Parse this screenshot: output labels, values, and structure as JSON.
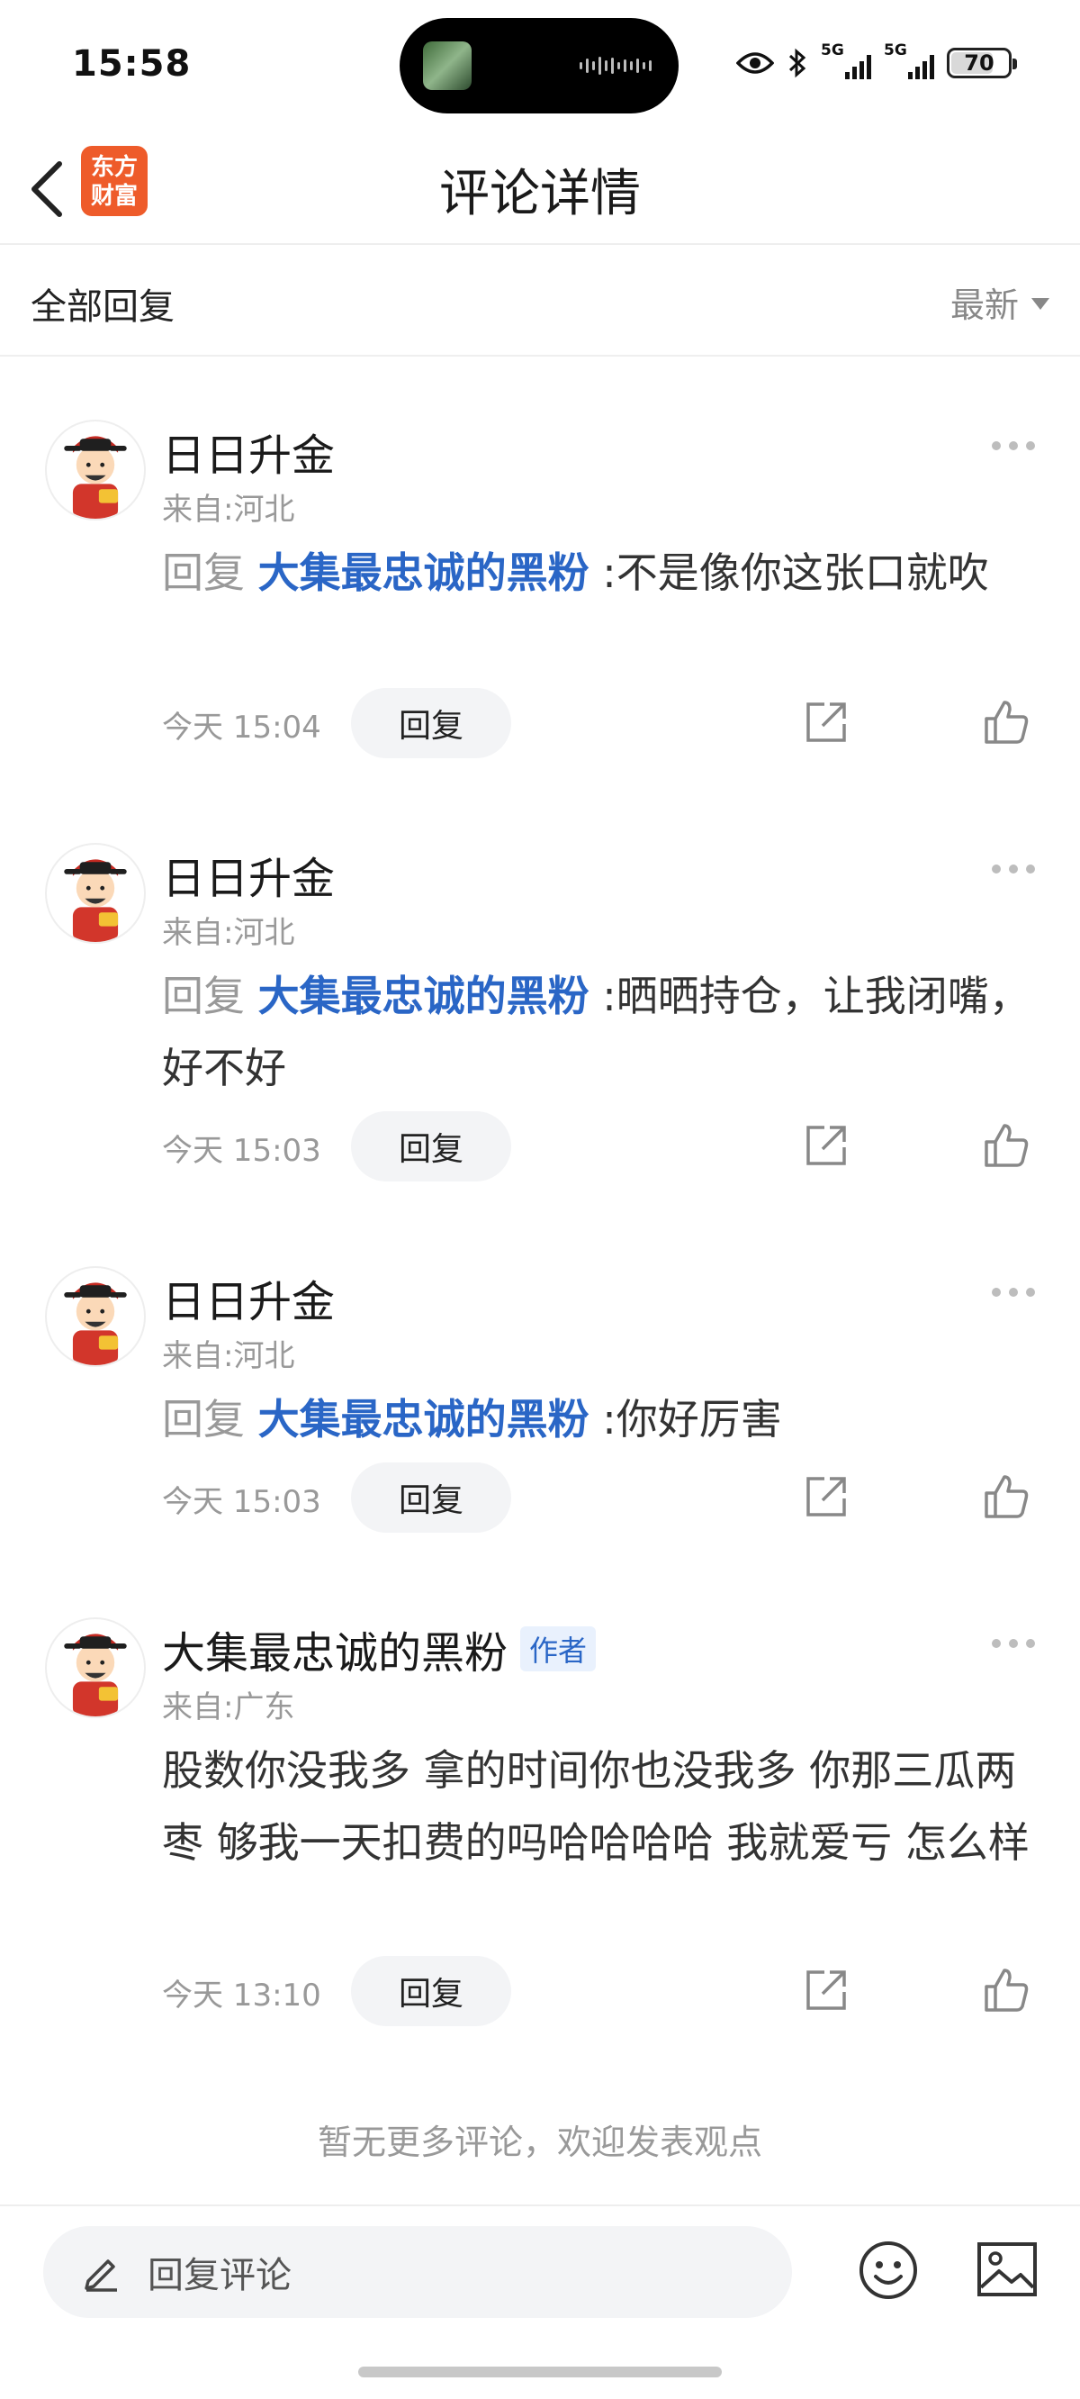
{
  "status_bar": {
    "time": "15:58",
    "network1": "5G",
    "network2": "5G",
    "battery": "70",
    "battery_level": 0.7
  },
  "header": {
    "logo_line1": "东方",
    "logo_line2": "财富",
    "title": "评论详情"
  },
  "filter": {
    "label": "全部回复",
    "sort": "最新"
  },
  "comments": [
    {
      "name": "日日升金",
      "location": "来自:河北",
      "reply_prefix": "回复",
      "mention": "大集最忠诚的黑粉",
      "separator": ":",
      "text": "不是像你这张口就吹",
      "time": "今天 15:04",
      "reply_label": "回复"
    },
    {
      "name": "日日升金",
      "location": "来自:河北",
      "reply_prefix": "回复",
      "mention": "大集最忠诚的黑粉",
      "separator": ":",
      "text": "晒晒持仓，让我闭嘴，好不好",
      "time": "今天 15:03",
      "reply_label": "回复"
    },
    {
      "name": "日日升金",
      "location": "来自:河北",
      "reply_prefix": "回复",
      "mention": "大集最忠诚的黑粉",
      "separator": ":",
      "text": "你好厉害",
      "time": "今天 15:03",
      "reply_label": "回复"
    },
    {
      "name": "大集最忠诚的黑粉",
      "author_tag": "作者",
      "location": "来自:广东",
      "text": "股数你没我多 拿的时间你也没我多 你那三瓜两枣 够我一天扣费的吗哈哈哈哈 我就爱亏 怎么样",
      "time": "今天 13:10",
      "reply_label": "回复"
    }
  ],
  "footer_note": "暂无更多评论，欢迎发表观点",
  "bottom_bar": {
    "input_placeholder": "回复评论"
  },
  "icons": [
    "back-icon",
    "more-icon",
    "share-icon",
    "like-icon",
    "pencil-icon",
    "emoji-icon",
    "image-icon",
    "eye-icon",
    "bluetooth-icon"
  ]
}
